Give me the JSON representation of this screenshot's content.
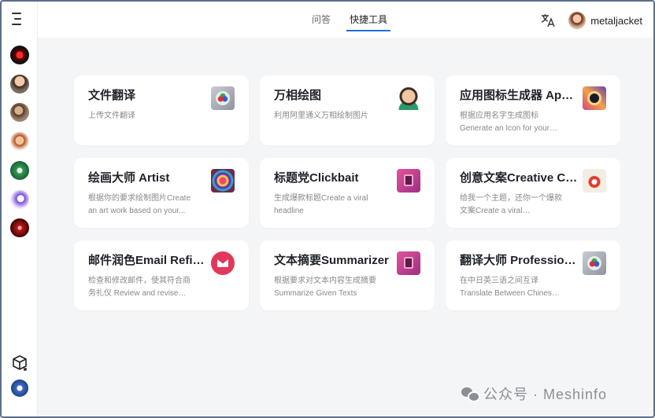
{
  "header": {
    "tabs": [
      {
        "label": "问答",
        "active": false
      },
      {
        "label": "快捷工具",
        "active": true
      }
    ],
    "translate_icon": "translate-icon",
    "username": "metaljacket"
  },
  "sidebar": {
    "toggle_icon": "menu-toggle-icon",
    "agents": [
      "agent-avatar",
      "agent-avatar",
      "agent-avatar",
      "agent-avatar",
      "agent-avatar",
      "agent-avatar",
      "agent-avatar"
    ],
    "bottom_icons": [
      "cube-icon",
      "user-avatar"
    ]
  },
  "cards": [
    {
      "title": "文件翻译",
      "desc": "上传文件翻译",
      "icon": "translate-doc-icon"
    },
    {
      "title": "万相绘图",
      "desc": "利用阿里通义万相绘制图片",
      "icon": "memoji-icon"
    },
    {
      "title": "应用图标生成器 App...",
      "desc": "根据应用名字生成图标 Generate an Icon for your App",
      "icon": "app-icon-generator-icon"
    },
    {
      "title": "绘画大师 Artist",
      "desc": "根据你的要求绘制图片Create an art work based on your...",
      "icon": "artist-icon"
    },
    {
      "title": "标题党Clickbait",
      "desc": "生成爆款标题Create a viral headline",
      "icon": "book-icon"
    },
    {
      "title": "创意文案Creative Co...",
      "desc": "给我一个主题，还你一个爆款文案Create a viral copywriting f...",
      "icon": "creative-icon"
    },
    {
      "title": "邮件润色Email Refin...",
      "desc": "检查和修改邮件，使其符合商务礼仪 Review and revise the...",
      "icon": "email-icon"
    },
    {
      "title": "文本摘要Summarizer",
      "desc": "根据要求对文本内容生成摘要 Summarize Given Texts",
      "icon": "book-icon"
    },
    {
      "title": "翻译大师 Profession...",
      "desc": "在中日英三语之间互译 Translate Between Chinese, English an...",
      "icon": "translate-doc-icon"
    }
  ],
  "watermark": {
    "text": "公众号 · Meshinfo"
  }
}
